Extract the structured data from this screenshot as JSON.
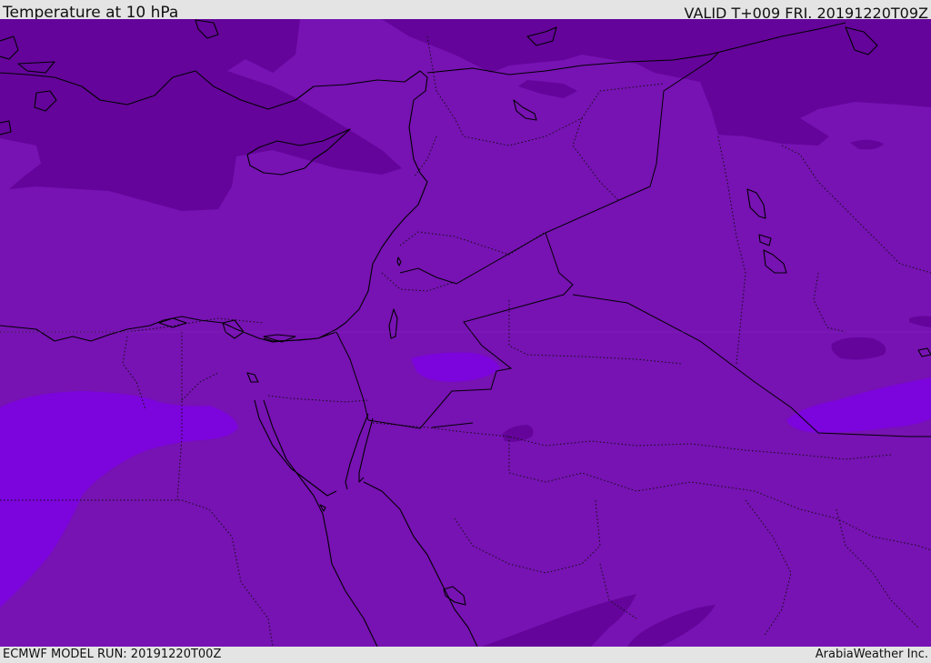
{
  "header": {
    "title": "Temperature at 10 hPa",
    "valid": "VALID T+009 FRI. 20191220T09Z"
  },
  "footer": {
    "model_run": "ECMWF MODEL RUN: 20191220T00Z",
    "credit": "ArabiaWeather Inc."
  },
  "colors": {
    "base_band": "#7712b3",
    "cold_band": "#64049a",
    "warm_band": "#7c04dc",
    "coastline": "#000000",
    "border": "#000000"
  }
}
